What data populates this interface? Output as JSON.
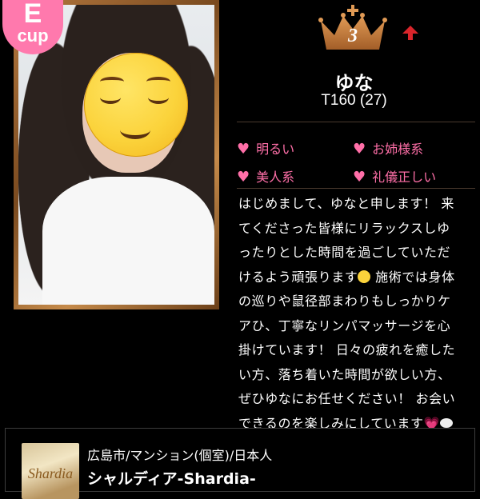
{
  "profile": {
    "cup": {
      "letter": "E",
      "word": "cup"
    },
    "rank": "3",
    "name": "ゆな",
    "stats": "T160 (27)",
    "photo": {
      "overlay_icon": "relieved-face-emoji-icon"
    },
    "tags": [
      "明るい",
      "お姉様系",
      "美人系",
      "礼儀正しい"
    ],
    "description_lines": [
      "はじめまして、ゆなと申します！ 来",
      "てくださった皆様にリラックスしゆ",
      "ったりとした時間を過ごしていただ",
      "けるよう頑張ります",
      " 施術では身体",
      "の巡りや鼠径部まわりもしっかりケ",
      "アひ、丁寧なリンパマッサージを心",
      "掛けています！ 日々の疲れを癒した",
      "い方、落ち着いた時間が欲しい方、",
      "ぜひゆなにお任せください！ お会い",
      "できるのを楽しみにしています"
    ],
    "inline_icons": [
      "relieved-face-emoji-icon",
      "sparkling-heart-icon",
      "speech-bubble-icon"
    ]
  },
  "shop": {
    "logo_text": "Shardia",
    "area": "広島市/マンション(個室)/日本人",
    "name": "シャルディア-Shardia-"
  },
  "colors": {
    "accent_pink": "#ff6fa8",
    "badge_pink": "#ff79ad",
    "crown_bronze": "#c2793c",
    "rank_up_red": "#d9252b",
    "background": "#000000"
  }
}
